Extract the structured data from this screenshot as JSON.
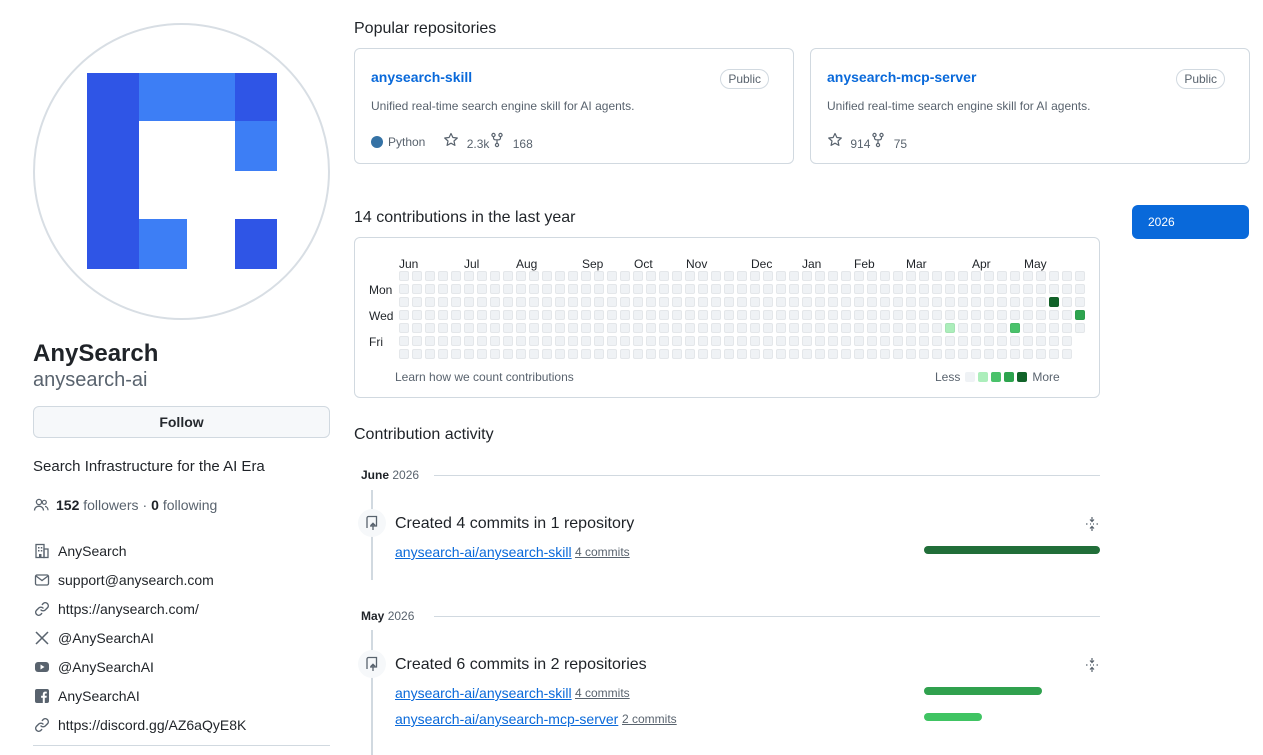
{
  "profile": {
    "name": "AnySearch",
    "login": "anysearch-ai",
    "follow_label": "Follow",
    "bio": "Search Infrastructure for the AI Era",
    "followers_count": "152",
    "followers_label": "followers",
    "separator": "·",
    "following_count": "0",
    "following_label": "following",
    "details": [
      {
        "icon": "organization-icon",
        "text": "AnySearch"
      },
      {
        "icon": "mail-icon",
        "text": "support@anysearch.com"
      },
      {
        "icon": "link-icon",
        "text": "https://anysearch.com/"
      },
      {
        "icon": "x-logo-icon",
        "text": "@AnySearchAI"
      },
      {
        "icon": "youtube-icon",
        "text": "@AnySearchAI"
      },
      {
        "icon": "facebook-icon",
        "text": "AnySearchAI"
      },
      {
        "icon": "link-icon",
        "text": "https://discord.gg/AZ6aQyE8K"
      }
    ]
  },
  "popular": {
    "title": "Popular repositories",
    "repos": [
      {
        "name": "anysearch-skill",
        "badge": "Public",
        "description": "Unified real-time search engine skill for AI agents.",
        "language": "Python",
        "language_color": "#3572A5",
        "stars": "2.3k",
        "forks": "168"
      },
      {
        "name": "anysearch-mcp-server",
        "badge": "Public",
        "description": "Unified real-time search engine skill for AI agents.",
        "stars": "914",
        "forks": "75"
      }
    ]
  },
  "contributions": {
    "title": "14 contributions in the last year",
    "months": [
      "Jun",
      "Jul",
      "Aug",
      "Sep",
      "Oct",
      "Nov",
      "Dec",
      "Jan",
      "Feb",
      "Mar",
      "Apr",
      "May"
    ],
    "day_labels": [
      "Mon",
      "Wed",
      "Fri"
    ],
    "footer_link": "Learn how we count contributions",
    "legend_less": "Less",
    "legend_more": "More",
    "colors": [
      "#eff2f5",
      "#aceebb",
      "#4ac26b",
      "#2da44e",
      "#116329"
    ],
    "active_cells": [
      {
        "week": 42,
        "day": 4,
        "level": 1
      },
      {
        "week": 47,
        "day": 4,
        "level": 2
      },
      {
        "week": 50,
        "day": 2,
        "level": 4
      },
      {
        "week": 52,
        "day": 3,
        "level": 3
      }
    ],
    "weeks": 53,
    "last_week_days": 5
  },
  "year_selector": {
    "selected": "2026"
  },
  "activity": {
    "title": "Contribution activity",
    "groups": [
      {
        "month": "June",
        "year": "2026",
        "summary": "Created 4 commits in 1 repository",
        "repos": [
          {
            "name": "anysearch-ai/anysearch-skill",
            "commits": "4 commits",
            "fraction": 1.0,
            "color": "#216e39"
          }
        ]
      },
      {
        "month": "May",
        "year": "2026",
        "summary": "Created 6 commits in 2 repositories",
        "repos": [
          {
            "name": "anysearch-ai/anysearch-skill",
            "commits": "4 commits",
            "fraction": 0.67,
            "color": "#30a14e"
          },
          {
            "name": "anysearch-ai/anysearch-mcp-server",
            "commits": "2 commits",
            "fraction": 0.33,
            "color": "#40c463"
          }
        ]
      }
    ]
  }
}
